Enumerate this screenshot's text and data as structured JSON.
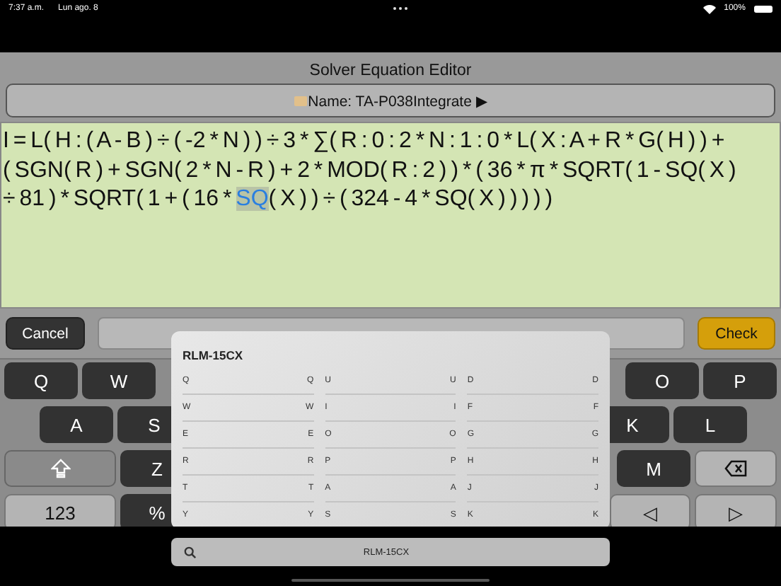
{
  "status_bar": {
    "time": "7:37 a.m.",
    "date": "Lun ago. 8",
    "battery": "100%"
  },
  "header": {
    "title": "Solver Equation Editor",
    "name_button": "Name: TA-P038Integrate ▶"
  },
  "equation": {
    "lines": [
      [
        {
          "text": "I = L( H : ( A - B ) ÷ ( -2 * N ) ) ÷ 3 * ∑( R : 0 : 2 * N : 1 : 0 * L( X : A + R * G( H ) ) +",
          "selected": false
        }
      ],
      [
        {
          "text": "( SGN( R ) + SGN( 2 * N - R ) + 2 * MOD( R : 2 ) ) * ( 36 * π * SQRT( 1 - SQ( X )",
          "selected": false
        }
      ],
      [
        {
          "text": "÷ 81 ) * SQRT( 1 + ( 16 * ",
          "selected": false
        },
        {
          "text": "SQ",
          "selected": true
        },
        {
          "text": "( X ) ) ÷ ( 324 - 4 * SQ( X ) ) ) ) )",
          "selected": false
        }
      ]
    ]
  },
  "actions": {
    "cancel": "Cancel",
    "check": "Check"
  },
  "keyboard": {
    "rows": [
      {
        "left": [
          {
            "label": "Q",
            "kind": "letter"
          },
          {
            "label": "W",
            "kind": "letter"
          }
        ],
        "right": [
          {
            "label": "O",
            "kind": "letter"
          },
          {
            "label": "P",
            "kind": "letter"
          }
        ]
      },
      {
        "left": [
          {
            "label": "A",
            "kind": "letter"
          },
          {
            "label": "S",
            "kind": "letter"
          }
        ],
        "right": [
          {
            "label": "K",
            "kind": "letter"
          },
          {
            "label": "L",
            "kind": "letter"
          }
        ]
      },
      {
        "left": [
          {
            "kind": "shift"
          },
          {
            "label": "Z",
            "kind": "letter"
          }
        ],
        "right": [
          {
            "label": "M",
            "kind": "letter"
          },
          {
            "kind": "backspace"
          }
        ]
      },
      {
        "left": [
          {
            "label": "123",
            "kind": "mode"
          },
          {
            "label": "%",
            "kind": "letter"
          }
        ],
        "right": [
          {
            "label": "◁",
            "kind": "mode"
          },
          {
            "label": "▷",
            "kind": "mode"
          }
        ]
      }
    ]
  },
  "popup": {
    "title": "RLM-15CX",
    "columns": [
      [
        {
          "key": "Q",
          "value": "Q"
        },
        {
          "key": "W",
          "value": "W"
        },
        {
          "key": "E",
          "value": "E"
        },
        {
          "key": "R",
          "value": "R"
        },
        {
          "key": "T",
          "value": "T"
        },
        {
          "key": "Y",
          "value": "Y"
        }
      ],
      [
        {
          "key": "U",
          "value": "U"
        },
        {
          "key": "I",
          "value": "I"
        },
        {
          "key": "O",
          "value": "O"
        },
        {
          "key": "P",
          "value": "P"
        },
        {
          "key": "A",
          "value": "A"
        },
        {
          "key": "S",
          "value": "S"
        }
      ],
      [
        {
          "key": "D",
          "value": "D"
        },
        {
          "key": "F",
          "value": "F"
        },
        {
          "key": "G",
          "value": "G"
        },
        {
          "key": "H",
          "value": "H"
        },
        {
          "key": "J",
          "value": "J"
        },
        {
          "key": "K",
          "value": "K"
        }
      ]
    ]
  },
  "search": {
    "value": "RLM-15CX"
  }
}
